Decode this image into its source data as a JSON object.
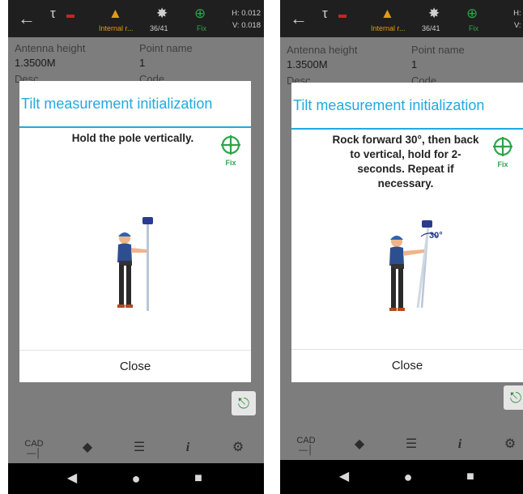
{
  "status_bar": {
    "internal_label": "Internal r...",
    "satellites": "36/41",
    "fix_label": "Fix",
    "h_value": "H: 0.012",
    "v_value": "V: 0.018"
  },
  "form": {
    "antenna_height_label": "Antenna height",
    "antenna_height_value": "1.3500M",
    "point_name_label": "Point name",
    "point_name_value": "1",
    "desc_label": "Desc",
    "code_label": "Code"
  },
  "toolbar": {
    "cad_label": "CAD"
  },
  "screens": [
    {
      "title": "Tilt measurement initialization",
      "instruction": "Hold the pole vertically.",
      "fix_label": "Fix",
      "close_label": "Close"
    },
    {
      "title": "Tilt measurement initialization",
      "instruction": "Rock forward 30°, then back to vertical, hold for 2-seconds. Repeat if necessary.",
      "tilt_angle": "30°",
      "fix_label": "Fix",
      "close_label": "Close"
    }
  ],
  "colors": {
    "accent_blue": "#21a9e1",
    "fix_green": "#2fa44a",
    "status_orange": "#e39a1a"
  }
}
